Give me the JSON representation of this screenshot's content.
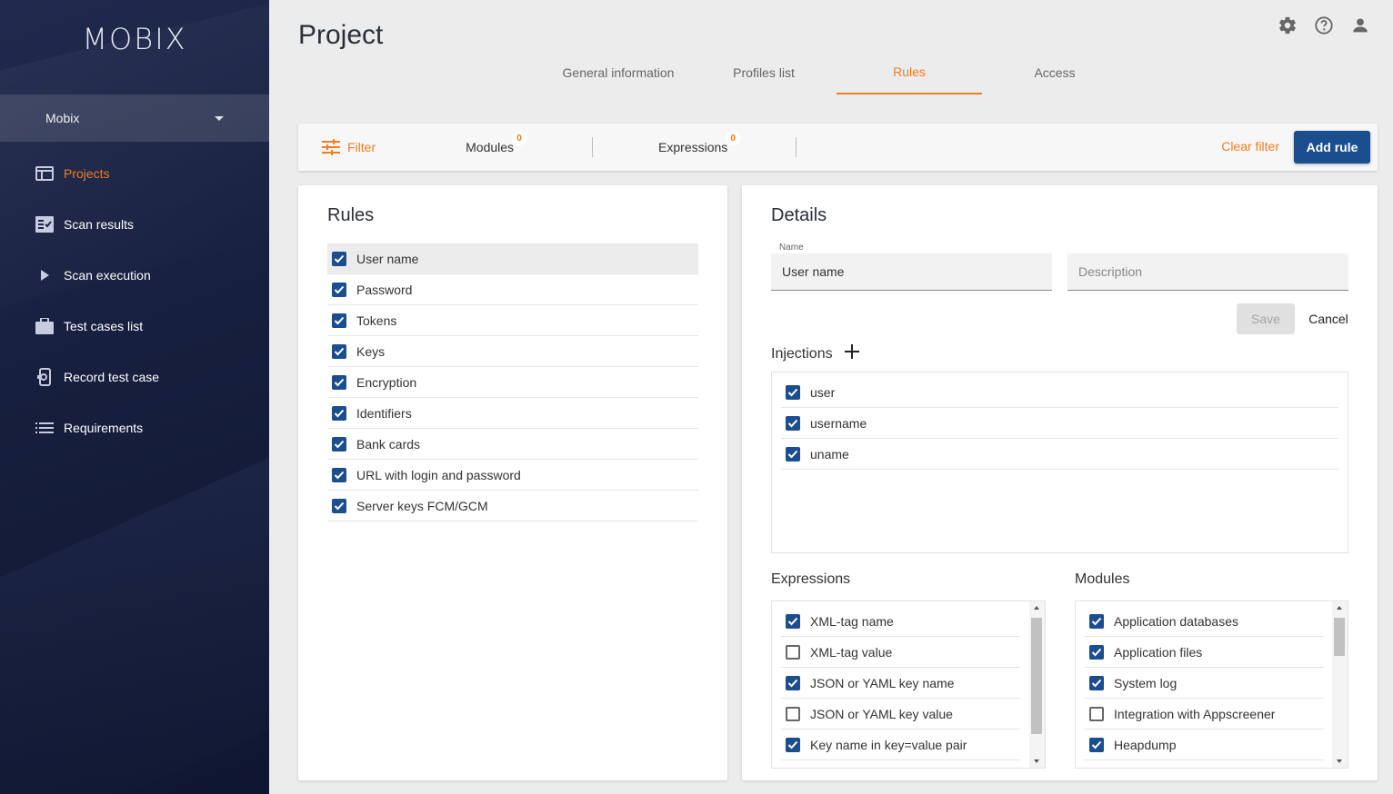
{
  "app": {
    "logo": "MOBIX"
  },
  "org_selector": {
    "value": "Mobix"
  },
  "nav": [
    {
      "label": "Projects",
      "icon": "projects-icon",
      "active": true
    },
    {
      "label": "Scan results",
      "icon": "scan-results-icon",
      "active": false
    },
    {
      "label": "Scan execution",
      "icon": "play-icon",
      "active": false
    },
    {
      "label": "Test cases list",
      "icon": "briefcase-icon",
      "active": false
    },
    {
      "label": "Record test case",
      "icon": "record-device-icon",
      "active": false
    },
    {
      "label": "Requirements",
      "icon": "list-icon",
      "active": false
    }
  ],
  "header": {
    "title": "Project",
    "tabs": [
      "General information",
      "Profiles list",
      "Rules",
      "Access"
    ],
    "active_tab": "Rules",
    "icons": [
      "gear-icon",
      "help-icon",
      "account-icon"
    ]
  },
  "filter_bar": {
    "filter_label": "Filter",
    "modules_label": "Modules",
    "modules_count": "0",
    "expressions_label": "Expressions",
    "expressions_count": "0",
    "clear_filter_label": "Clear filter",
    "add_rule_label": "Add rule"
  },
  "rules": {
    "title": "Rules",
    "items": [
      {
        "label": "User name",
        "checked": true,
        "selected": true
      },
      {
        "label": "Password",
        "checked": true
      },
      {
        "label": "Tokens",
        "checked": true
      },
      {
        "label": "Keys",
        "checked": true
      },
      {
        "label": "Encryption",
        "checked": true
      },
      {
        "label": "Identifiers",
        "checked": true
      },
      {
        "label": "Bank cards",
        "checked": true
      },
      {
        "label": "URL with login and password",
        "checked": true
      },
      {
        "label": "Server keys FCM/GCM",
        "checked": true
      }
    ]
  },
  "details": {
    "title": "Details",
    "name_label": "Name",
    "name_value": "User name",
    "description_placeholder": "Description",
    "save_label": "Save",
    "cancel_label": "Cancel",
    "injections_label": "Injections",
    "injections": [
      {
        "label": "user",
        "checked": true
      },
      {
        "label": "username",
        "checked": true
      },
      {
        "label": "uname",
        "checked": true
      }
    ],
    "expressions_label": "Expressions",
    "expressions": [
      {
        "label": "XML-tag name",
        "checked": true
      },
      {
        "label": "XML-tag value",
        "checked": false
      },
      {
        "label": "JSON or YAML key name",
        "checked": true
      },
      {
        "label": "JSON or YAML key value",
        "checked": false
      },
      {
        "label": "Key name in key=value pair",
        "checked": true
      }
    ],
    "modules_label": "Modules",
    "modules": [
      {
        "label": "Application databases",
        "checked": true
      },
      {
        "label": "Application files",
        "checked": true
      },
      {
        "label": "System log",
        "checked": true
      },
      {
        "label": "Integration with Appscreener",
        "checked": false
      },
      {
        "label": "Heapdump",
        "checked": true
      }
    ]
  },
  "colors": {
    "accent": "#f57c1f",
    "primary": "#1a4e8f",
    "sidebar": "#161f3d"
  }
}
